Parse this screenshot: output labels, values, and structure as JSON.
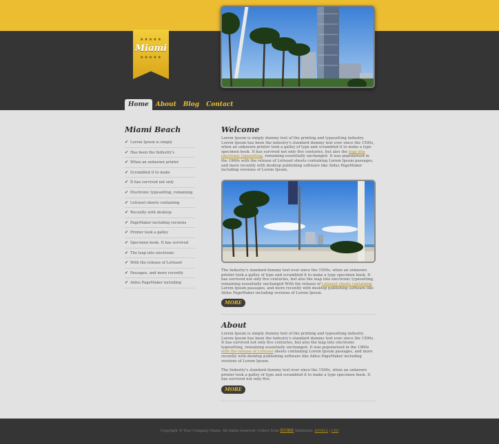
{
  "logo": {
    "stars": "★★★★★",
    "brand": "Miami"
  },
  "nav": [
    "Home",
    "About",
    "Blog",
    "Contact"
  ],
  "sidebar": {
    "title": "Miami Beach",
    "items": [
      "Lorem Ipsum is simply",
      "Has been the Industry's",
      "When an unknown printer",
      "Scrambled it to make",
      "It has survived not only",
      "Electronic typesetting, remaining",
      "Letraset sheets containing",
      "Recently with desktop",
      "PageMaker including versions",
      "Printer took a galley",
      "Specimen book. It has survived",
      "The leap into electronic",
      "With the release of Letraset",
      "Passages, and more recently",
      "Aldus PageMaker including"
    ]
  },
  "welcome": {
    "title": "Welcome",
    "para1_a": "Lorem Ipsum is simply dummy text of the printing and typesetting industry. Lorem Ipsum has been the industry's standard dummy text ever since the 1500s, when an unknown printer took a galley of type and scrambled it to make a type specimen book. It has survived not only five centuries, but also the ",
    "para1_link": "leap into electronic typesetting",
    "para1_b": ", remaining essentially unchanged. It was popularised in the 1960s with the release of Letraset sheets containing Lorem Ipsum passages, and more recently with desktop publishing software like Aldus PageMaker including versions of Lorem Ipsum.",
    "para2_a": "The Industry's standard dummy text ever since the 1500s, when an unknown printer took a galley of type and scrambled it to make a type specimen book. It has survived not only five centuries, but also the leap into electronic typesetting, remaining essentially unchanged With the release of ",
    "para2_link": "Letraset sheets containing",
    "para2_b": " Lorem Ipsum passages, and more recently with desktop publishing software like Aldus PageMaker including versions of Lorem Ipsum.",
    "more": "MORE"
  },
  "about": {
    "title": "About",
    "para1_a": "Lorem Ipsum is simply dummy text of the printing and typesetting industry. Lorem Ipsum has been the industry's standard dummy text ever since the 1500s. It has survived not only five centuries, but also the leap into electronic typesetting, remaining essentially unchanged. It was popularised in the 1960s ",
    "para1_link": "with the release of Letraset",
    "para1_b": " sheets containing Lorem Ipsum passages, and more recently with desktop publishing software like Aldus PageMaker including versions of Lorem Ipsum.",
    "para2": "The Industry's standard dummy text ever since the 1500s, when an unknown printer took a galley of type and scrambled it to make a type specimen book. It has survived not only five.",
    "more": "MORE"
  },
  "footer": {
    "copyright": "Copyright © Your Company Name. All rights reserved. Collect from ",
    "collect_link": "网页模板",
    "validation": " Validation: ",
    "html_link": "HTML5",
    "sep": " | ",
    "css_link": "CSS"
  },
  "colors": {
    "accent": "#ecbd31",
    "dark": "#353535",
    "page": "#e2e2e2"
  }
}
